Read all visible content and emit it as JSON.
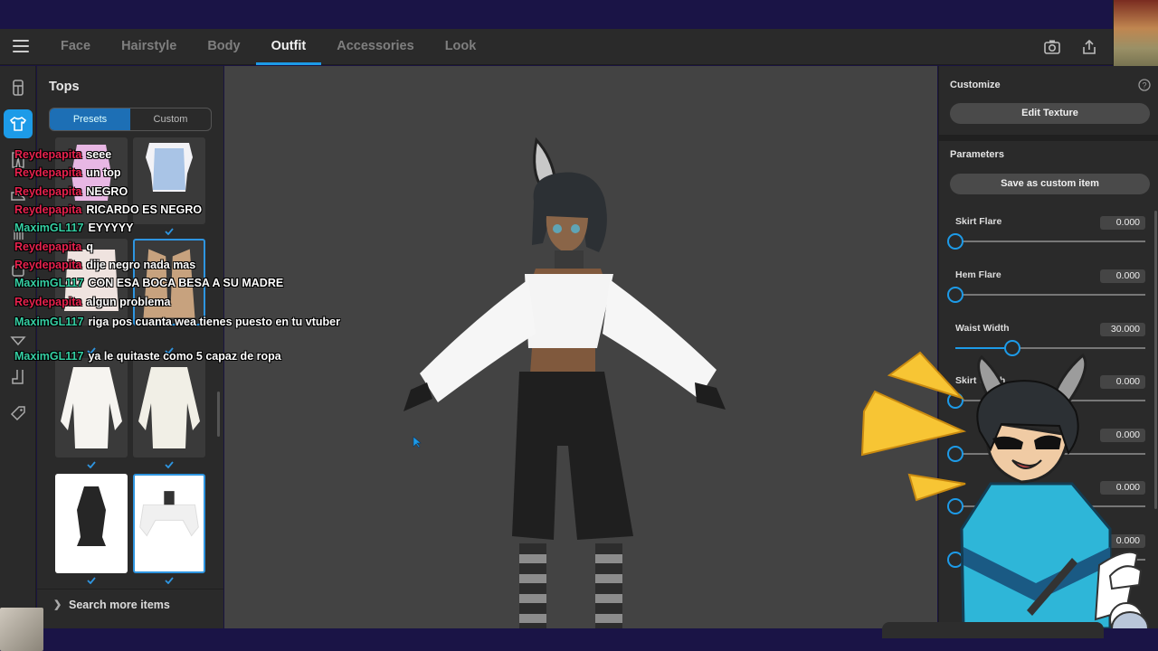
{
  "nav": {
    "tabs": [
      {
        "label": "Face"
      },
      {
        "label": "Hairstyle"
      },
      {
        "label": "Body"
      },
      {
        "label": "Outfit"
      },
      {
        "label": "Accessories"
      },
      {
        "label": "Look"
      }
    ],
    "active_tab": "Outfit",
    "icons": [
      "menu-icon",
      "camera-icon",
      "share-icon"
    ]
  },
  "sidebar_icons": [
    "hanger-icon",
    "shirt-icon",
    "pants-icon",
    "shoe-icon",
    "glove-icon",
    "bag-icon",
    "collar-icon",
    "sock-icon",
    "tag-icon"
  ],
  "left_panel": {
    "title": "Tops",
    "segment": {
      "presets": "Presets",
      "custom": "Custom",
      "active": "Presets"
    },
    "search_more": "Search more items"
  },
  "right_panel": {
    "customize": {
      "title": "Customize",
      "edit_texture": "Edit Texture"
    },
    "parameters": {
      "title": "Parameters",
      "save_custom": "Save as custom item",
      "items": [
        {
          "label": "Skirt Flare",
          "value": "0.000",
          "fraction": 0.0
        },
        {
          "label": "Hem Flare",
          "value": "0.000",
          "fraction": 0.0
        },
        {
          "label": "Waist Width",
          "value": "30.000",
          "fraction": 0.3
        },
        {
          "label": "Skirt Width",
          "value": "0.000",
          "fraction": 0.0
        },
        {
          "label": "",
          "value": "0.000",
          "fraction": 0.0
        },
        {
          "label": "",
          "value": "0.000",
          "fraction": 0.0
        },
        {
          "label": "",
          "value": "0.000",
          "fraction": 0.0
        }
      ]
    }
  },
  "chat": [
    {
      "user": "Reydepapita",
      "msg": "seee",
      "color": "#e8224e"
    },
    {
      "user": "Reydepapita",
      "msg": "un top",
      "color": "#e8224e"
    },
    {
      "user": "Reydepapita",
      "msg": "NEGRO",
      "color": "#e8224e"
    },
    {
      "user": "Reydepapita",
      "msg": "RICARDO ES NEGRO",
      "color": "#e8224e"
    },
    {
      "user": "MaximGL117",
      "msg": "EYYYYY",
      "color": "#35cfa3"
    },
    {
      "user": "Reydepapita",
      "msg": "q",
      "color": "#e8224e"
    },
    {
      "user": "Reydepapita",
      "msg": "dije negro nada mas",
      "color": "#e8224e"
    },
    {
      "user": "MaximGL117",
      "msg": "CON ESA BOCA BESA A SU MADRE",
      "color": "#35cfa3"
    },
    {
      "user": "Reydepapita",
      "msg": "algun problema",
      "color": "#e8224e"
    },
    {
      "user": "MaximGL117",
      "msg": "riga pos cuanta wea tienes puesto en tu vtuber",
      "color": "#35cfa3"
    },
    {
      "user": "MaximGL117",
      "msg": "ya le quitaste como 5 capaz de ropa",
      "color": "#35cfa3"
    }
  ]
}
